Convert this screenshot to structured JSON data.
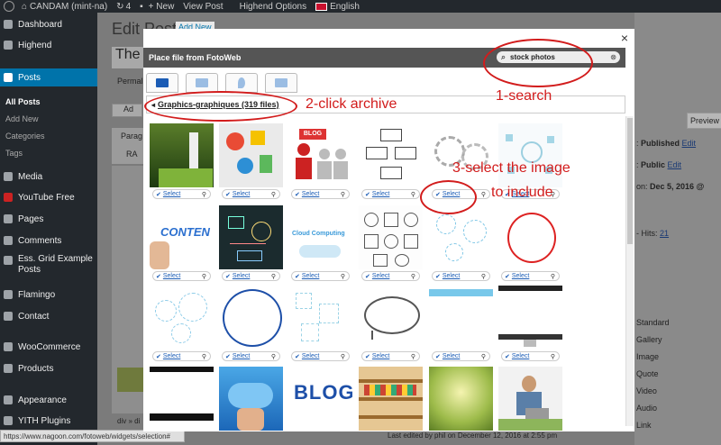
{
  "admin_bar": {
    "site_name": "CANDAM (mint-na)",
    "updates": "4",
    "new_label": "+ New",
    "view_post": "View Post",
    "highend_options": "Highend Options",
    "language": "English"
  },
  "sidebar": {
    "items": [
      {
        "label": "Dashboard",
        "icon": "dashboard-icon"
      },
      {
        "label": "Highend",
        "icon": "highend-icon"
      },
      {
        "label": "Posts",
        "icon": "pin-icon"
      },
      {
        "label": "Media",
        "icon": "media-icon"
      },
      {
        "label": "YouTube Free",
        "icon": "youtube-icon"
      },
      {
        "label": "Pages",
        "icon": "pages-icon"
      },
      {
        "label": "Comments",
        "icon": "comments-icon"
      },
      {
        "label": "Ess. Grid Example Posts",
        "icon": "grid-icon"
      },
      {
        "label": "Flamingo",
        "icon": "flamingo-icon"
      },
      {
        "label": "Contact",
        "icon": "contact-icon"
      },
      {
        "label": "WooCommerce",
        "icon": "woocommerce-icon"
      },
      {
        "label": "Products",
        "icon": "products-icon"
      },
      {
        "label": "Appearance",
        "icon": "appearance-icon"
      },
      {
        "label": "YITH Plugins",
        "icon": "yith-icon"
      }
    ],
    "sub_items": [
      "All Posts",
      "Add New",
      "Categories",
      "Tags"
    ]
  },
  "editor": {
    "title": "Edit Post",
    "add_new": "Add New",
    "post_title_partial": "The",
    "permalink_partial": "Permal",
    "add_media_partial": "Ad",
    "paragraph_partial": "Parag",
    "ra_partial": "RA",
    "div_partial": "div » di"
  },
  "right_panel": {
    "preview": "Preview",
    "status": "Published",
    "status_edit": "Edit",
    "visibility": "Public",
    "visibility_edit": "Edit",
    "published_on": "Dec 5, 2016 @",
    "hits_label": "Hits:",
    "hits_value": "21",
    "formats": [
      "Standard",
      "Gallery",
      "Image",
      "Quote",
      "Video",
      "Audio",
      "Link"
    ]
  },
  "status_bar": "https://www.nagoon.com/fotoweb/widgets/selection#",
  "last_edited": "Last edited by phil on December 12, 2016 at 2:55 pm",
  "modal": {
    "title": "Place file from FotoWeb",
    "close": "×",
    "search_value": "stock photos",
    "tabs": [
      {
        "name": "archive",
        "active": true
      },
      {
        "name": "briefcase",
        "active": false
      },
      {
        "name": "map",
        "active": false
      },
      {
        "name": "upload",
        "active": false
      }
    ],
    "breadcrumb": "Graphics-graphiques (319 files)",
    "select_label": "Select",
    "grid_items": [
      {
        "kind": "golf"
      },
      {
        "kind": "colorful-doodles"
      },
      {
        "kind": "blog-people"
      },
      {
        "kind": "flowchart"
      },
      {
        "kind": "gears"
      },
      {
        "kind": "network-icons"
      },
      {
        "kind": "content-hand"
      },
      {
        "kind": "chalkboard-doodles"
      },
      {
        "kind": "cloud-computing"
      },
      {
        "kind": "icon-sketches"
      },
      {
        "kind": "bubbles"
      },
      {
        "kind": "red-circle"
      },
      {
        "kind": "bubbles-2"
      },
      {
        "kind": "blue-circle"
      },
      {
        "kind": "squares"
      },
      {
        "kind": "speech-bubble"
      },
      {
        "kind": "blue-stripe"
      },
      {
        "kind": "monitor"
      },
      {
        "kind": "monitor-dark"
      },
      {
        "kind": "cloud-hand"
      },
      {
        "kind": "blog-3d"
      },
      {
        "kind": "shelves"
      },
      {
        "kind": "bokeh"
      },
      {
        "kind": "woman-laptop"
      }
    ],
    "cloud_computing_text": "Cloud Computing",
    "content_text": "CONTEN",
    "blog_sign_text": "BLOG",
    "blog_3d_text": "BLOG"
  },
  "annotations": {
    "search": "1-search",
    "click_archive": "2-click archive",
    "select_image_line1": "3-select the image",
    "select_image_line2": "to include"
  },
  "colors": {
    "annotation": "#d21c1c",
    "accent": "#1b5cb5",
    "admin_dark": "#23282d",
    "active_menu": "#0073aa"
  }
}
